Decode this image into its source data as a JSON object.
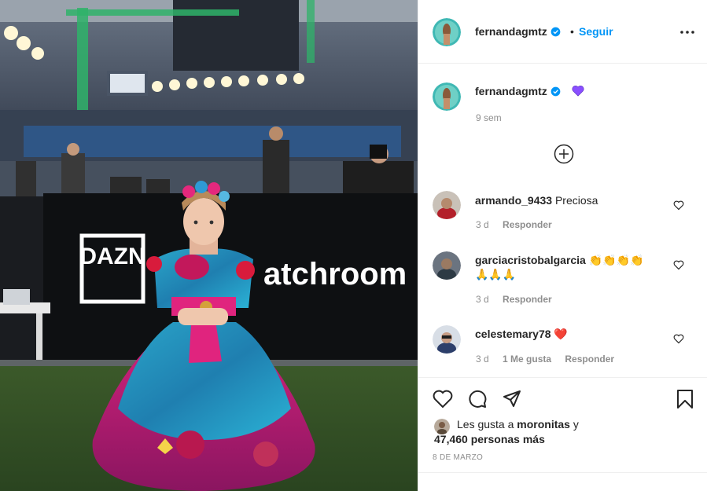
{
  "post": {
    "photo_overlay": {
      "banner_left": "DAZN",
      "banner_right": "atchroom"
    },
    "header": {
      "username": "fernandagmtz",
      "separator": "•",
      "follow_label": "Seguir"
    },
    "caption": {
      "username": "fernandagmtz",
      "time": "9 sem"
    },
    "comments": [
      {
        "username": "armando_9433",
        "text": "Preciosa",
        "emoji": "",
        "emoji2": "",
        "time": "3 d",
        "likes": "",
        "reply_label": "Responder"
      },
      {
        "username": "garciacristobalgarcia",
        "text": "",
        "emoji": "👏👏👏👏",
        "emoji2": "🙏🙏🙏",
        "time": "3 d",
        "likes": "",
        "reply_label": "Responder"
      },
      {
        "username": "celestemary78",
        "text": "",
        "emoji": "❤️",
        "emoji2": "",
        "time": "3 d",
        "likes": "1 Me gusta",
        "reply_label": "Responder"
      }
    ],
    "likes": {
      "prefix": "Les gusta a",
      "first_user": "moronitas",
      "connector": "y",
      "count_text": "47,460 personas más"
    },
    "date": "8 DE MARZO"
  },
  "colors": {
    "link": "#0095f6",
    "text": "#262626",
    "secondary": "#8e8e8e",
    "heart_red": "#ed4956",
    "heart_purple": "#8a4fff"
  },
  "icons": [
    "verified-badge-icon",
    "more-options-icon",
    "purple-heart-icon",
    "load-more-icon",
    "heart-outline-icon",
    "comment-icon",
    "share-icon",
    "bookmark-icon"
  ]
}
